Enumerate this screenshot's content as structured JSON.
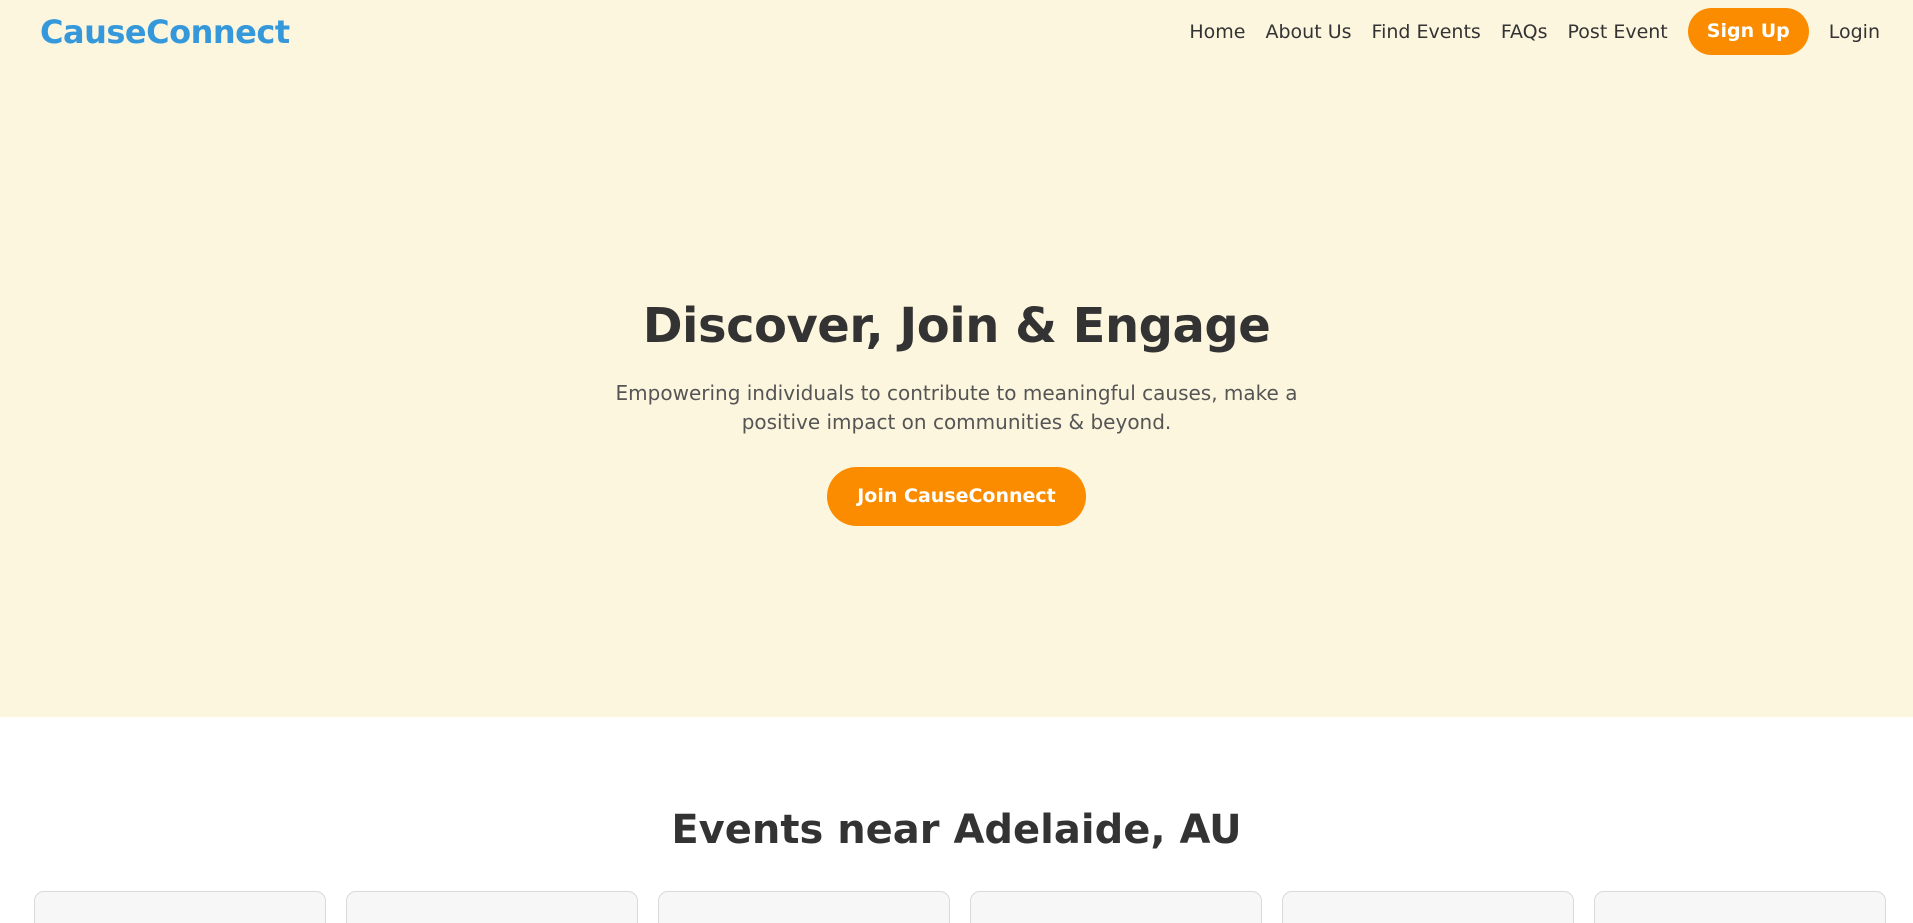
{
  "brand": {
    "name": "CauseConnect",
    "color": "#3498db"
  },
  "nav": {
    "links": [
      "Home",
      "About Us",
      "Find Events",
      "FAQs",
      "Post Event"
    ],
    "signup_label": "Sign Up",
    "login_label": "Login"
  },
  "hero": {
    "title": "Discover, Join & Engage",
    "subtitle": "Empowering individuals to contribute to meaningful causes, make a positive impact on communities & beyond.",
    "cta_label": "Join CauseConnect",
    "background": "#fdf6df"
  },
  "events": {
    "title": "Events near Adelaide, AU",
    "card_count": 6
  },
  "colors": {
    "accent": "#fb8c00",
    "text": "#333333",
    "muted_text": "#555555"
  }
}
